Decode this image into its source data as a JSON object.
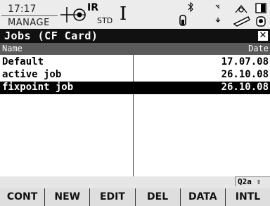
{
  "status": {
    "time": "17:17",
    "mode": "MANAGE",
    "ir": "IR",
    "std": "STD",
    "cursor": "I"
  },
  "title": "Jobs (CF Card)",
  "columns": {
    "name": "Name",
    "date": "Date"
  },
  "jobs": [
    {
      "name": "Default",
      "date": "17.07.08"
    },
    {
      "name": "active job",
      "date": "26.10.08"
    },
    {
      "name": "fixpoint job",
      "date": "26.10.08"
    }
  ],
  "selected_index": 2,
  "input_mode": "Q2a",
  "softkeys": [
    "CONT",
    "NEW",
    "EDIT",
    "DEL",
    "DATA",
    "INTL"
  ],
  "icons": [
    "plus-icon",
    "antenna-icon",
    "bluetooth-icon",
    "battery-icon",
    "card-icon",
    "tilt-icon"
  ]
}
